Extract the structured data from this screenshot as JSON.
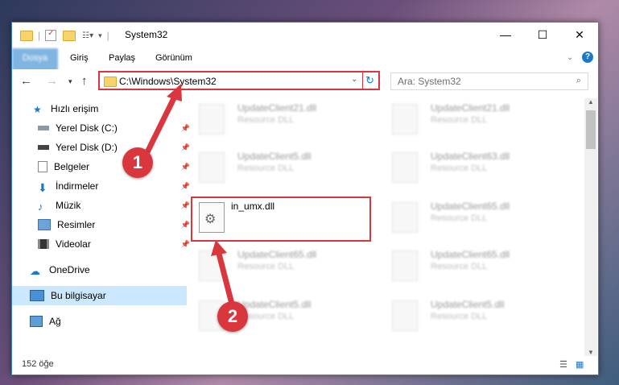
{
  "titlebar": {
    "title": "System32"
  },
  "ribbon": {
    "tabs": [
      "Dosya",
      "Giriş",
      "Paylaş",
      "Görünüm"
    ]
  },
  "address": {
    "path": "C:\\Windows\\System32"
  },
  "search": {
    "placeholder": "Ara: System32"
  },
  "sidebar": {
    "items": [
      {
        "label": "Hızlı erişim"
      },
      {
        "label": "Yerel Disk (C:)"
      },
      {
        "label": "Yerel Disk (D:)"
      },
      {
        "label": "Belgeler"
      },
      {
        "label": "İndirmeler"
      },
      {
        "label": "Müzik"
      },
      {
        "label": "Resimler"
      },
      {
        "label": "Videolar"
      },
      {
        "label": "OneDrive"
      },
      {
        "label": "Bu bilgisayar"
      },
      {
        "label": "Ağ"
      }
    ]
  },
  "files": [
    {
      "name": "UpdateClient21.dll",
      "type": "Resource DLL"
    },
    {
      "name": "UpdateClient21.dll",
      "type": "Resource DLL"
    },
    {
      "name": "UpdateClient5.dll",
      "type": "Resource DLL"
    },
    {
      "name": "UpdateClient63.dll",
      "type": "Resource DLL"
    },
    {
      "name": "in_umx.dll",
      "type": ""
    },
    {
      "name": "UpdateClient65.dll",
      "type": "Resource DLL"
    },
    {
      "name": "UpdateClient65.dll",
      "type": "Resource DLL"
    },
    {
      "name": "UpdateClient65.dll",
      "type": "Resource DLL"
    },
    {
      "name": "UpdateClient5.dll",
      "type": "Resource DLL"
    },
    {
      "name": "UpdateClient5.dll",
      "type": "Resource DLL"
    }
  ],
  "statusbar": {
    "count": "152 öğe"
  },
  "callouts": [
    "1",
    "2"
  ],
  "colors": {
    "accent": "#1979ca",
    "highlight": "#d9363e",
    "selected": "#cce8ff"
  }
}
